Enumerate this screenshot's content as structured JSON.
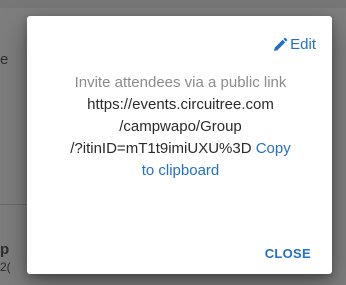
{
  "dialog": {
    "edit_label": "Edit",
    "caption": "Invite attendees via a public link",
    "link_lines": [
      "https://events.circuitree.com",
      "/campwapo/Group",
      "/?itinID=mT1t9imiUXU%3D"
    ],
    "copy_label_part1": "Copy",
    "copy_label_part2": "to clipboard",
    "close_label": "CLOSE"
  },
  "background": {
    "peek_letter_1": "e",
    "peek_letter_2": "p",
    "peek_text_3": "2("
  },
  "colors": {
    "accent": "#2271c7",
    "caption": "#8b8b8b",
    "text": "#2b2b2b",
    "overlay": "#7e7e7e"
  }
}
